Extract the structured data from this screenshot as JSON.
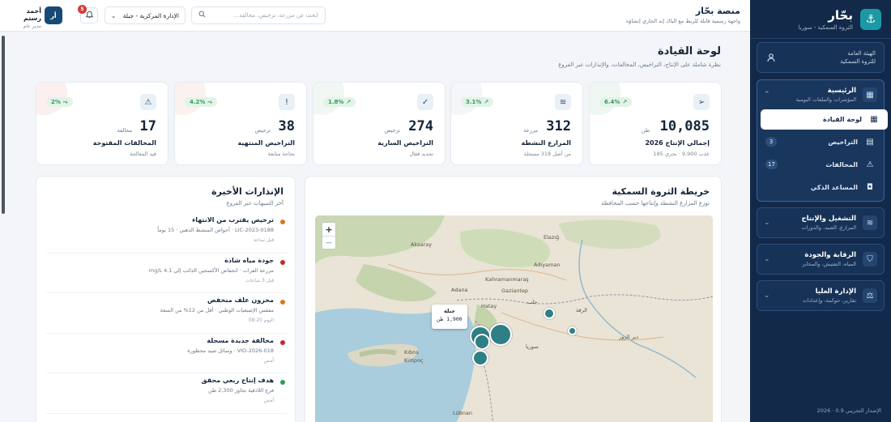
{
  "sidebar": {
    "brand_name": "بحّار",
    "brand_sub": "الثروة السمكية - سوريا",
    "org_line1": "الهيئة العامة",
    "org_line2": "للثروة السمكية",
    "groups": [
      {
        "title": "الرئيسية",
        "sub": "المؤشرات والملفات اليومية"
      },
      {
        "title": "التشغيل والإنتاج",
        "sub": "المزارع، الصيد، والدورات"
      },
      {
        "title": "الرقابة والجودة",
        "sub": "المياه، التفتيش، والمخابر"
      },
      {
        "title": "الإدارة العليا",
        "sub": "تقارير، حوكمة، وإعدادات"
      }
    ],
    "items": [
      {
        "label": "لوحة القيادة",
        "badge": ""
      },
      {
        "label": "التراخيص",
        "badge": "3"
      },
      {
        "label": "المخالفات",
        "badge": "17"
      },
      {
        "label": "المساعد الذكي",
        "badge": ""
      }
    ],
    "version": "الإصدار التجريبي 0.9 · 2026"
  },
  "header": {
    "title": "منصة بحّار",
    "subtitle": "واجهة رسمية قابلة للربط مع الباك إند الجاري إنشاؤه",
    "search_placeholder": "ابحث عن مزرعة، ترخيص، مخالفة...",
    "branch": "الإدارة المركزية - جبلة",
    "notifications": "5",
    "avatar": "أر",
    "user_name": "أحمد رستم",
    "user_role": "مدير عام"
  },
  "page": {
    "title": "لوحة القيادة",
    "subtitle": "نظرة شاملة على الإنتاج، التراخيص، المخالفات، والإنذارات عبر الفروع"
  },
  "kpis": [
    {
      "value": "10,085",
      "unit": "طن",
      "label": "إجمالي الإنتاج 2026",
      "note": "عذب 9,900 · بحري 185",
      "trend": "6.4%",
      "trend_dir": "up",
      "icon": "fish-icon",
      "color": "#2e9c5a"
    },
    {
      "value": "312",
      "unit": "مزرعة",
      "label": "المزارع النشطة",
      "note": "من أصل 318 مسجلة",
      "trend": "3.1%",
      "trend_dir": "up",
      "icon": "waves-icon",
      "color": "#2e9c5a"
    },
    {
      "value": "274",
      "unit": "ترخيص",
      "label": "التراخيص السارية",
      "note": "تجديد فعال",
      "trend": "1.8%",
      "trend_dir": "up",
      "icon": "check-circle-icon",
      "color": "#2e9c5a"
    },
    {
      "value": "38",
      "unit": "ترخيص",
      "label": "التراخيص المنتهية",
      "note": "بحاجة متابعة",
      "trend": "4.2%",
      "trend_dir": "flat",
      "icon": "document-alert-icon",
      "color": "#2e9c5a"
    },
    {
      "value": "17",
      "unit": "مخالفة",
      "label": "المخالفات المفتوحة",
      "note": "قيد المعالجة",
      "trend": "2%",
      "trend_dir": "flat",
      "icon": "warning-icon",
      "color": "#2e9c5a"
    }
  ],
  "alerts": {
    "title": "الإنذارات الأخيرة",
    "subtitle": "آخر التنبيهات عبر الفروع",
    "items": [
      {
        "title": "ترخيص يقترب من الانتهاء",
        "desc": "LIC-2023-0188 · أحواض المنشط الذهبي · 15 يوماً",
        "time": "قبل ساعة",
        "color": "#d97a1f"
      },
      {
        "title": "جودة مياه شاذة",
        "desc": "مزرعة الفرات · انخفاض الأكسجين الذائب إلى 4.1 mg/L",
        "time": "قبل 3 ساعات",
        "color": "#c62828"
      },
      {
        "title": "مخزون علف منخفض",
        "desc": "مفقس الإصبعيات الوطني · أقل من 12% من السعة",
        "time": "اليوم 08:20",
        "color": "#d97a1f"
      },
      {
        "title": "مخالفة جديدة مسجلة",
        "desc": "VIO-2026-018 · وسائل صيد محظورة",
        "time": "أمس",
        "color": "#c62828"
      },
      {
        "title": "هدف إنتاج ربعي محقق",
        "desc": "فرع اللاذقية تجاوز 2,300 طن",
        "time": "أمس",
        "color": "#2e9c5a"
      }
    ]
  },
  "map": {
    "title": "خريطة الثروة السمكية",
    "subtitle": "توزع المزارع النشطة وإنتاجها حسب المحافظة",
    "tooltip_name": "جبلة",
    "tooltip_value": "1,900 طن",
    "labels": [
      "Aksaray",
      "Elazığ",
      "Adıyaman",
      "Kahramanmaraş",
      "Gaziantep",
      "Adana",
      "Hatay",
      "Kıbrıs",
      "Κύπρος",
      "Lübnan",
      "سوريا",
      "حلب",
      "الرقة",
      "دير الزور"
    ]
  }
}
